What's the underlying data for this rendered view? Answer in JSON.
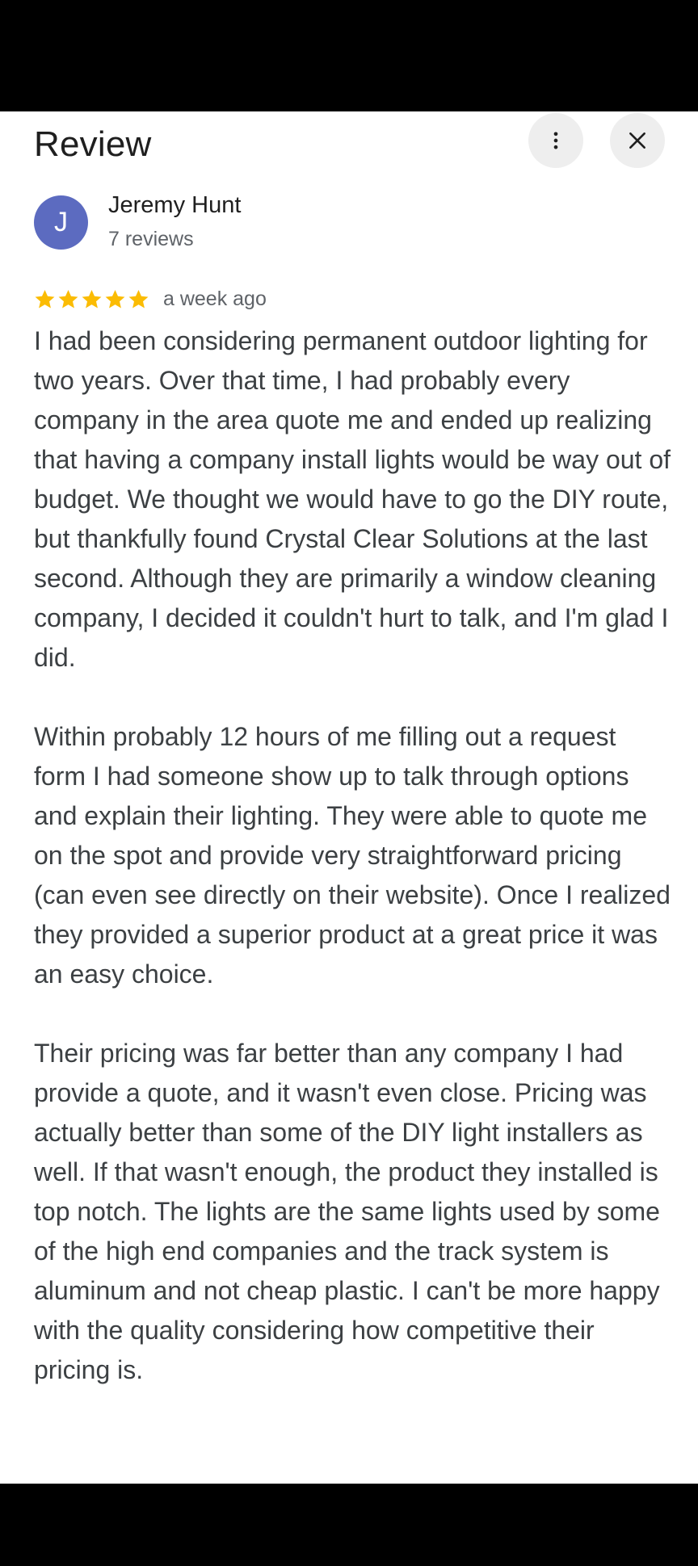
{
  "header": {
    "title": "Review",
    "more_icon": "more-vert-icon",
    "close_icon": "close-icon"
  },
  "author": {
    "initial": "J",
    "name": "Jeremy Hunt",
    "meta": "7 reviews",
    "avatar_color": "#5c6bc0"
  },
  "rating": {
    "stars": 5,
    "max": 5,
    "star_color": "#fbbc04",
    "date": "a week ago"
  },
  "review": {
    "paragraphs": [
      "I had been considering permanent outdoor lighting for two years. Over that time, I had probably every company in the area quote me and ended up realizing that having a company install lights would be way out of budget. We thought we would have to go the DIY route, but thankfully found Crystal Clear Solutions at the last second. Although they are primarily a window cleaning company, I decided it couldn't hurt to talk, and I'm glad I did.",
      "Within probably 12 hours of me filling out a request form I had someone show up to talk through options and explain their lighting. They were able to quote me on the spot and provide very straightforward pricing (can even see directly on their website). Once I realized they provided a superior product at a great price it was an easy choice.",
      "Their pricing was far better than any company I had provide a quote, and it wasn't even close. Pricing was actually better than some of the DIY light installers as well. If that wasn't enough, the product they installed is top notch. The lights are the same lights used by some of the high end companies and the track system is aluminum and not cheap plastic. I can't be more happy with the quality considering how competitive their pricing is."
    ]
  }
}
